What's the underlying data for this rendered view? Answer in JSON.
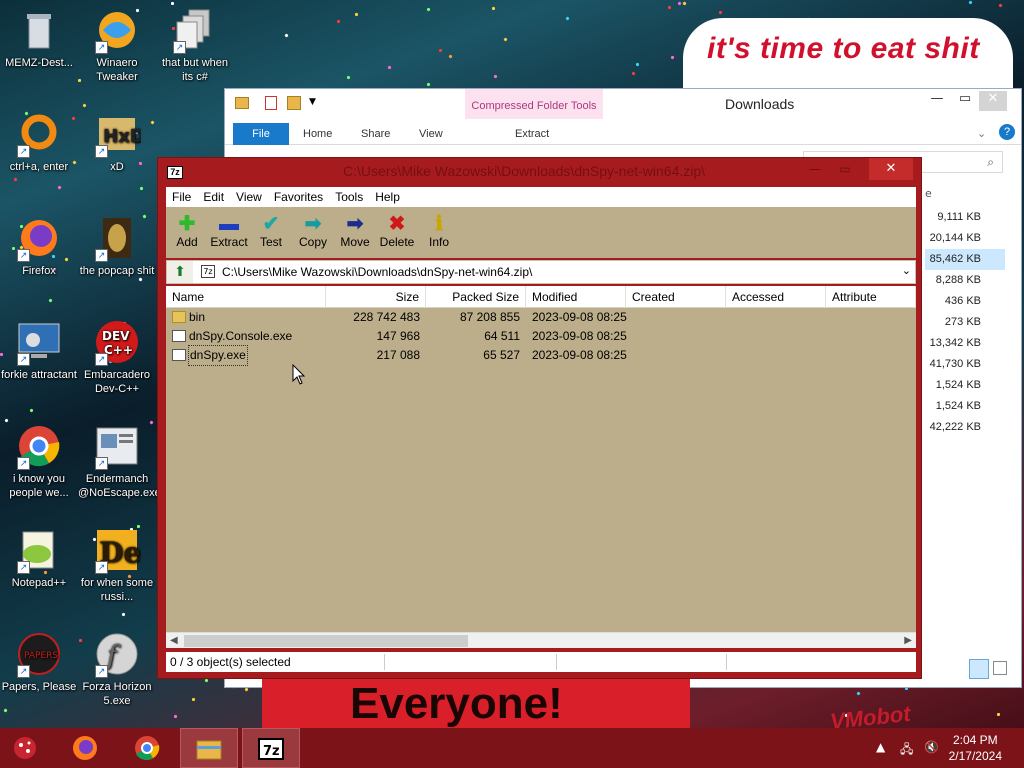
{
  "desktop": {
    "icons": [
      {
        "label": "MEMZ-Dest...",
        "icon": "recycle-bin-icon"
      },
      {
        "label": "Winaero Tweaker",
        "icon": "winaero-icon"
      },
      {
        "label": "that but when its c#",
        "icon": "document-stack-icon"
      },
      {
        "label": "ctrl+a, enter",
        "icon": "orange-ring-icon"
      },
      {
        "label": "xD",
        "icon": "hxd-icon"
      },
      {
        "label": "Firefox",
        "icon": "firefox-icon"
      },
      {
        "label": "the popcap shit",
        "icon": "popcap-icon"
      },
      {
        "label": "forkie attractant",
        "icon": "monitor-gear-icon"
      },
      {
        "label": "Embarcadero Dev-C++",
        "icon": "devcpp-icon"
      },
      {
        "label": "i know you people we...",
        "icon": "chrome-icon"
      },
      {
        "label": "Endermanch @NoEscape.exe",
        "icon": "noescape-icon"
      },
      {
        "label": "Notepad++",
        "icon": "notepadpp-icon"
      },
      {
        "label": "for when some russi...",
        "icon": "de-icon"
      },
      {
        "label": "Papers, Please",
        "icon": "papers-please-icon"
      },
      {
        "label": "Forza Horizon 5.exe",
        "icon": "flash-icon"
      }
    ]
  },
  "banner_top": "it's time to eat shit",
  "banner_bottom": "Everyone!",
  "banner_corner": "VMobot",
  "explorer": {
    "title": "Downloads",
    "context_tab": "Compressed Folder Tools",
    "tabs": [
      "File",
      "Home",
      "Share",
      "View"
    ],
    "context_subtab": "Extract",
    "sizes": [
      "9,111 KB",
      "20,144 KB",
      "85,462 KB",
      "8,288 KB",
      "436 KB",
      "273 KB",
      "13,342 KB",
      "41,730 KB",
      "1,524 KB",
      "1,524 KB",
      "42,222 KB"
    ]
  },
  "sevenzip": {
    "title": "C:\\Users\\Mike Wazowski\\Downloads\\dnSpy-net-win64.zip\\",
    "app_icon_text": "7z",
    "menu": [
      "File",
      "Edit",
      "View",
      "Favorites",
      "Tools",
      "Help"
    ],
    "toolbar": [
      {
        "label": "Add",
        "icon": "add-icon",
        "glyph": "✚",
        "color": "#2dbb2d"
      },
      {
        "label": "Extract",
        "icon": "extract-icon",
        "glyph": "▬",
        "color": "#1d3fbf"
      },
      {
        "label": "Test",
        "icon": "test-icon",
        "glyph": "✔",
        "color": "#1aa8a8"
      },
      {
        "label": "Copy",
        "icon": "copy-icon",
        "glyph": "➡",
        "color": "#169c9c"
      },
      {
        "label": "Move",
        "icon": "move-icon",
        "glyph": "➡",
        "color": "#1b2c8f"
      },
      {
        "label": "Delete",
        "icon": "delete-icon",
        "glyph": "✖",
        "color": "#d01818"
      },
      {
        "label": "Info",
        "icon": "info-icon",
        "glyph": "ℹ",
        "color": "#c7a600"
      }
    ],
    "address": "C:\\Users\\Mike Wazowski\\Downloads\\dnSpy-net-win64.zip\\",
    "columns": [
      "Name",
      "Size",
      "Packed Size",
      "Modified",
      "Created",
      "Accessed",
      "Attribute"
    ],
    "rows": [
      {
        "name": "bin",
        "type": "folder",
        "size": "228 742 483",
        "packed": "87 208 855",
        "modified": "2023-09-08 08:25"
      },
      {
        "name": "dnSpy.Console.exe",
        "type": "exe",
        "size": "147 968",
        "packed": "64 511",
        "modified": "2023-09-08 08:25"
      },
      {
        "name": "dnSpy.exe",
        "type": "exe",
        "size": "217 088",
        "packed": "65 527",
        "modified": "2023-09-08 08:25"
      }
    ],
    "status": "0 / 3 object(s) selected"
  },
  "taskbar": {
    "apps": [
      {
        "icon": "firefox-icon"
      },
      {
        "icon": "chrome-icon"
      },
      {
        "icon": "file-explorer-icon"
      },
      {
        "icon": "sevenzip-icon",
        "text": "7z"
      }
    ],
    "time": "2:04 PM",
    "date": "2/17/2024"
  }
}
